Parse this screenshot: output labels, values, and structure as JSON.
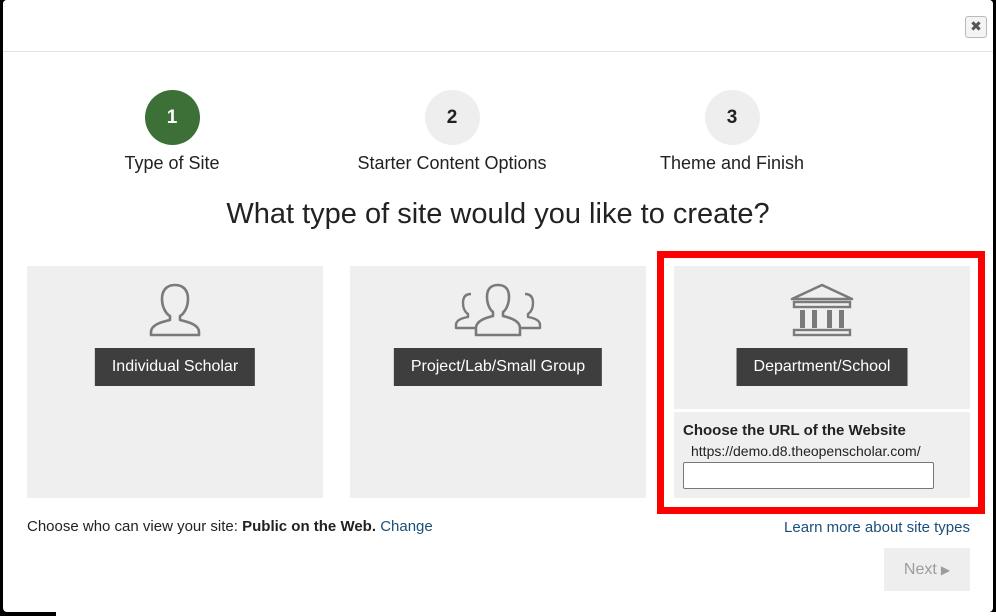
{
  "dialog": {
    "close_glyph": "✖"
  },
  "steps": [
    {
      "number": "1",
      "label": "Type of Site",
      "active": true
    },
    {
      "number": "2",
      "label": "Starter Content Options",
      "active": false
    },
    {
      "number": "3",
      "label": "Theme and Finish",
      "active": false
    }
  ],
  "heading": "What type of site would you like to create?",
  "site_types": [
    {
      "label": "Individual Scholar",
      "icon": "person-icon"
    },
    {
      "label": "Project/Lab/Small Group",
      "icon": "group-icon"
    },
    {
      "label": "Department/School",
      "icon": "building-icon",
      "selected": true
    }
  ],
  "url_section": {
    "label": "Choose the URL of the Website",
    "base_url": "https://demo.d8.theopenscholar.com/",
    "value": ""
  },
  "privacy": {
    "prefix": "Choose who can view your site:",
    "value": "Public on the Web.",
    "change_link": "Change"
  },
  "learn_more": "Learn more about site types",
  "next": {
    "label": "Next",
    "arrow": "▶"
  },
  "colors": {
    "active_step": "#3c7037",
    "button_dark": "#3e3e3e",
    "highlight_border": "#ff0000",
    "link": "#1a4f7a"
  }
}
